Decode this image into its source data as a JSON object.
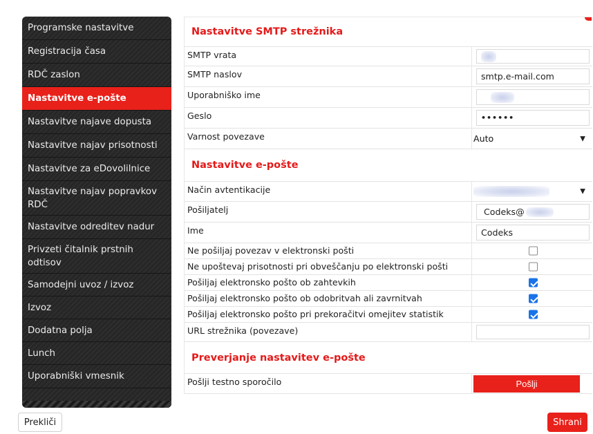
{
  "sidebar": {
    "items": [
      {
        "label": "Programske nastavitve",
        "active": false
      },
      {
        "label": "Registracija časa",
        "active": false
      },
      {
        "label": "RDČ zaslon",
        "active": false
      },
      {
        "label": "Nastavitve e-pošte",
        "active": true
      },
      {
        "label": "Nastavitve najave dopusta",
        "active": false
      },
      {
        "label": "Nastavitve najav prisotnosti",
        "active": false
      },
      {
        "label": "Nastavitve za eDovolilnice",
        "active": false
      },
      {
        "label": "Nastavitve najav popravkov RDČ",
        "active": false
      },
      {
        "label": "Nastavitve odreditev nadur",
        "active": false
      },
      {
        "label": "Privzeti čitalnik prstnih odtisov",
        "active": false
      },
      {
        "label": "Samodejni uvoz / izvoz",
        "active": false
      },
      {
        "label": "Izvoz",
        "active": false
      },
      {
        "label": "Dodatna polja",
        "active": false
      },
      {
        "label": "Lunch",
        "active": false
      },
      {
        "label": "Uporabniški vmesnik",
        "active": false
      }
    ]
  },
  "smtp": {
    "title": "Nastavitve SMTP strežnika",
    "port_label": "SMTP vrata",
    "address_label": "SMTP naslov",
    "address_value": "smtp.e-mail.com",
    "username_label": "Uporabniško ime",
    "password_label": "Geslo",
    "password_value": "••••••",
    "security_label": "Varnost povezave",
    "security_value": "Auto"
  },
  "email": {
    "title": "Nastavitve e-pošte",
    "auth_label": "Način avtentikacije",
    "sender_label": "Pošiljatelj",
    "sender_value": "Codeks@",
    "name_label": "Ime",
    "name_value": "Codeks",
    "checkboxes": [
      {
        "label": "Ne pošiljaj povezav v elektronski pošti",
        "checked": false
      },
      {
        "label": "Ne upoštevaj prisotnosti pri obveščanju po elektronski pošti",
        "checked": false
      },
      {
        "label": "Pošiljaj elektronsko pošto ob zahtevkih",
        "checked": true
      },
      {
        "label": "Pošiljaj elektronsko pošto ob odobritvah ali zavrnitvah",
        "checked": true
      },
      {
        "label": "Pošiljaj elektronsko pošto pri prekoračitvi omejitev statistik",
        "checked": true
      }
    ],
    "url_label": "URL strežnika (povezave)"
  },
  "verify": {
    "title": "Preverjanje nastavitev e-pošte",
    "send_test_label": "Pošlji testno sporočilo",
    "send_button": "Pošlji"
  },
  "footer": {
    "cancel_label": "Prekliči",
    "save_label": "Shrani"
  },
  "colors": {
    "accent": "#e8211a",
    "sidebar_bg": "#262626",
    "checkbox_checked": "#1a73e8"
  }
}
